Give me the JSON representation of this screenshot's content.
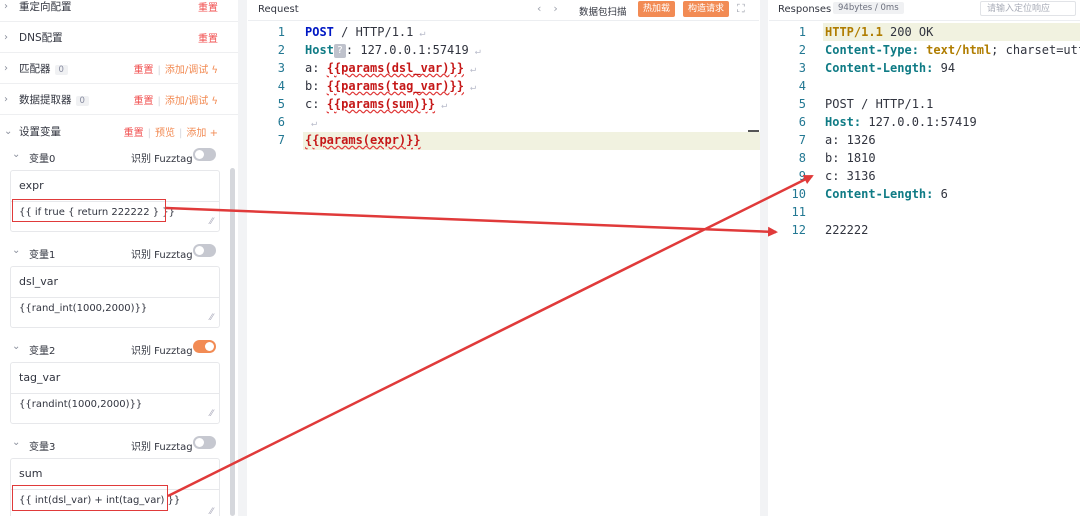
{
  "left_panel": {
    "sections": [
      {
        "title": "重定向配置",
        "badge": "",
        "actions": [
          "重置"
        ]
      },
      {
        "title": "DNS配置",
        "badge": "",
        "actions": [
          "重置"
        ]
      },
      {
        "title": "匹配器",
        "badge": "0",
        "actions": [
          "重置",
          "添加/调试"
        ]
      },
      {
        "title": "数据提取器",
        "badge": "0",
        "actions": [
          "重置",
          "添加/调试"
        ]
      },
      {
        "title": "设置变量",
        "badge": "",
        "actions": [
          "重置",
          "预览",
          "添加"
        ]
      }
    ],
    "variables": [
      {
        "label": "变量0",
        "fuzztag_label": "识别 Fuzztag",
        "fuzztag_on": false,
        "key": "expr",
        "value": "{{ if true { return 222222 } }}"
      },
      {
        "label": "变量1",
        "fuzztag_label": "识别 Fuzztag",
        "fuzztag_on": false,
        "key": "dsl_var",
        "value": "{{rand_int(1000,2000)}}"
      },
      {
        "label": "变量2",
        "fuzztag_label": "识别 Fuzztag",
        "fuzztag_on": true,
        "key": "tag_var",
        "value": "{{randint(1000,2000)}}"
      },
      {
        "label": "变量3",
        "fuzztag_label": "识别 Fuzztag",
        "fuzztag_on": false,
        "key": "sum",
        "value": "{{ int(dsl_var) + int(tag_var) }}"
      }
    ],
    "icons": {
      "collapse": "chevron-down-icon",
      "add": "plus-icon",
      "debug": "bolt-icon"
    }
  },
  "request": {
    "title": "Request",
    "toolbar": {
      "prev": "‹",
      "next": "›",
      "scan": "数据包扫描",
      "hot_load": "热加载",
      "build": "构造请求"
    },
    "lines": [
      {
        "n": "1",
        "parts": [
          [
            "kw",
            "POST"
          ],
          [
            "p",
            " / HTTP/1.1"
          ]
        ]
      },
      {
        "n": "2",
        "parts": [
          [
            "hdr",
            "Host"
          ],
          [
            "q",
            "?"
          ],
          [
            "p",
            ": 127.0.0.1:57419"
          ]
        ]
      },
      {
        "n": "3",
        "parts": [
          [
            "p",
            "a: "
          ],
          [
            "tpl",
            "{{params(dsl_var)}}"
          ]
        ]
      },
      {
        "n": "4",
        "parts": [
          [
            "p",
            "b: "
          ],
          [
            "tpl",
            "{{params(tag_var)}}"
          ]
        ]
      },
      {
        "n": "5",
        "parts": [
          [
            "p",
            "c: "
          ],
          [
            "tpl",
            "{{params(sum)}}"
          ]
        ]
      },
      {
        "n": "6",
        "parts": []
      },
      {
        "n": "7",
        "parts": [
          [
            "tpl",
            "{{params(expr)}}"
          ]
        ]
      }
    ]
  },
  "response": {
    "title": "Responses",
    "stats": "94bytes / 0ms",
    "locate_placeholder": "请输入定位响应",
    "lines": [
      {
        "n": "1",
        "parts": [
          [
            "yel",
            "HTTP/1.1"
          ],
          [
            "p",
            " 200 OK"
          ]
        ]
      },
      {
        "n": "2",
        "parts": [
          [
            "hdr",
            "Content-Type:"
          ],
          [
            "yel",
            " text/html"
          ],
          [
            "p",
            "; charset=utf"
          ]
        ]
      },
      {
        "n": "3",
        "parts": [
          [
            "hdr",
            "Content-Length:"
          ],
          [
            "p",
            " 94"
          ]
        ]
      },
      {
        "n": "4",
        "parts": []
      },
      {
        "n": "5",
        "parts": [
          [
            "p",
            "POST / HTTP/1.1"
          ]
        ]
      },
      {
        "n": "6",
        "parts": [
          [
            "hdr",
            "Host:"
          ],
          [
            "p",
            " 127.0.0.1:57419"
          ]
        ]
      },
      {
        "n": "7",
        "parts": [
          [
            "p",
            "a: 1326"
          ]
        ]
      },
      {
        "n": "8",
        "parts": [
          [
            "p",
            "b: 1810"
          ]
        ]
      },
      {
        "n": "9",
        "parts": [
          [
            "p",
            "c: 3136"
          ]
        ]
      },
      {
        "n": "10",
        "parts": [
          [
            "hdr",
            "Content-Length:"
          ],
          [
            "p",
            " 6"
          ]
        ]
      },
      {
        "n": "11",
        "parts": []
      },
      {
        "n": "12",
        "parts": [
          [
            "p",
            "222222"
          ]
        ]
      }
    ]
  },
  "colors": {
    "accent": "#f28b54",
    "danger": "#f14f4f",
    "annotation": "#e03a3a"
  }
}
